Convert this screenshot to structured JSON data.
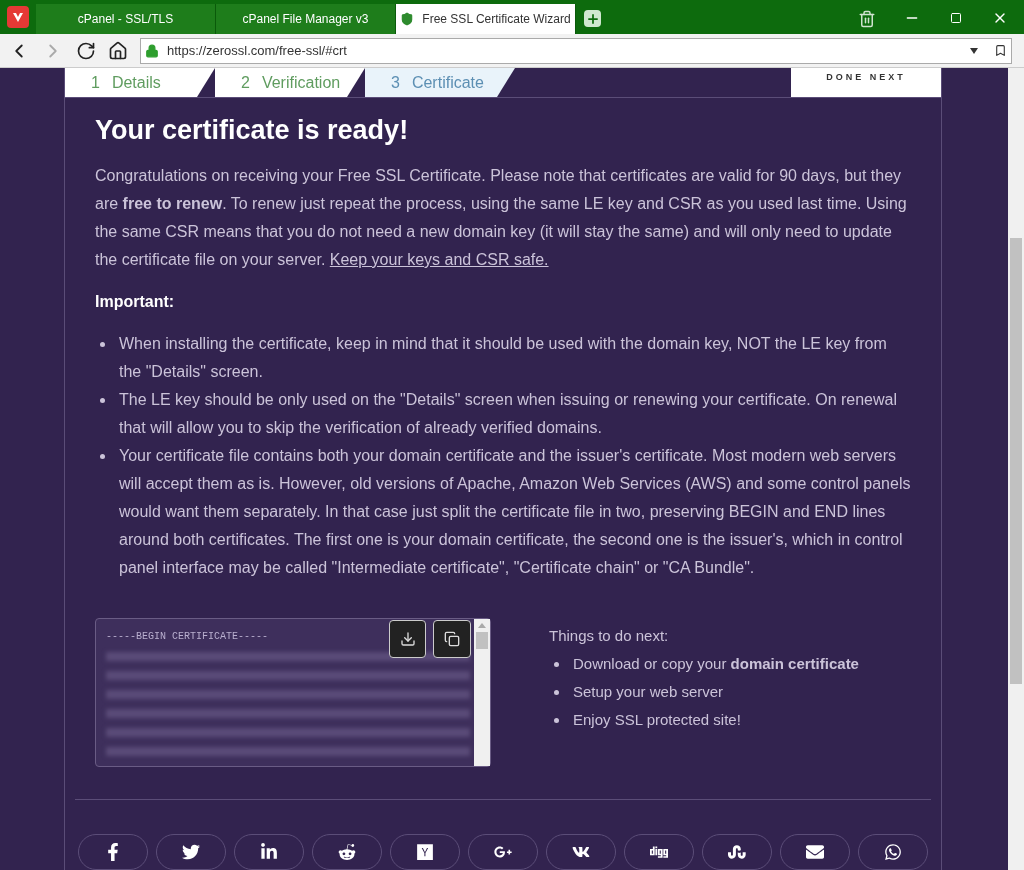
{
  "browser": {
    "tabs": [
      {
        "title": "cPanel - SSL/TLS",
        "selected": false
      },
      {
        "title": "cPanel File Manager v3",
        "selected": false
      },
      {
        "title": "Free SSL Certificate Wizard",
        "selected": true
      }
    ],
    "url": "https://zerossl.com/free-ssl/#crt"
  },
  "steps": [
    {
      "number": "1",
      "label": "Details",
      "selected": false
    },
    {
      "number": "2",
      "label": "Verification",
      "selected": false
    },
    {
      "number": "3",
      "label": "Certificate",
      "selected": true
    }
  ],
  "next_button": "DONE NEXT",
  "heading": "Your certificate is ready!",
  "intro": {
    "text": "Congratulations on receiving your Free SSL Certificate. Please note that certificates are valid for 90 days, but they are **free to renew**. To renew just repeat the process, using the same LE key and CSR as you used last time. Using the same CSR means that you do not need a new domain key (it will stay the same) and will only need to update the certificate file on your server.",
    "link": "Keep your keys and CSR safe."
  },
  "important_title": "Important:",
  "important_items": [
    "When installing the certificate, keep in mind that it should be used with the domain key, NOT the LE key from the \"Details\" screen.",
    "The LE key should be only used on the \"Details\" screen when issuing or renewing your certificate. On renewal that will allow you to skip the verification of already verified domains.",
    "Your certificate file contains both your domain certificate and the issuer's certificate. Most modern web servers will accept them as is. However, old versions of Apache, Amazon Web Services (AWS) and some control panels would want them separately. In that case just split the certificate file in two, preserving BEGIN and END lines around both certificates. The first one is your domain certificate, the second one is the issuer's, which in control panel interface may be called \"Intermediate certificate\", \"Certificate chain\" or \"CA Bundle\"."
  ],
  "certificate": {
    "first_line": "-----BEGIN CERTIFICATE-----"
  },
  "next_steps": {
    "title": "Things to do next:",
    "items": [
      "Download or copy your **domain certificate**",
      "Setup your web server",
      "Enjoy SSL protected site!"
    ]
  },
  "share_buttons": [
    {
      "kind": "facebook"
    },
    {
      "kind": "twitter"
    },
    {
      "kind": "linkedin"
    },
    {
      "kind": "reddit"
    },
    {
      "kind": "hackernews"
    },
    {
      "kind": "googleplus"
    },
    {
      "kind": "vk"
    },
    {
      "kind": "digg"
    },
    {
      "kind": "stumbleupon"
    },
    {
      "kind": "email"
    },
    {
      "kind": "whatsapp"
    }
  ]
}
